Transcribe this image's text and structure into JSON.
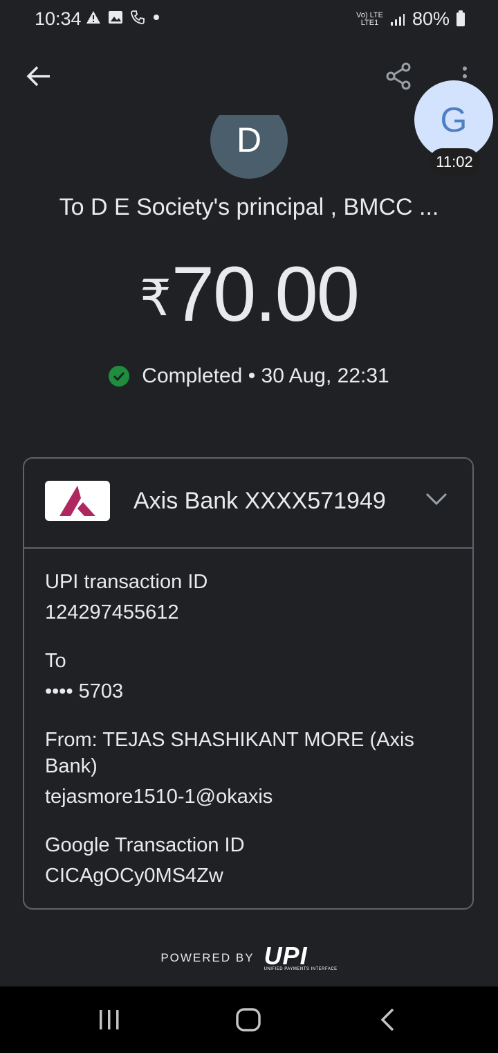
{
  "status_bar": {
    "time": "10:34",
    "net_top": "Vo) LTE",
    "net_bottom": "LTE1",
    "battery": "80%"
  },
  "bubble": {
    "letter": "G",
    "time": "11:02"
  },
  "payee": {
    "avatar_letter": "D",
    "to_line": "To D E Society's principal , BMCC ..."
  },
  "amount": {
    "currency": "₹",
    "value": "70.00"
  },
  "status": {
    "text": "Completed • 30 Aug, 22:31",
    "color": "#1e8e3e"
  },
  "account": {
    "bank_name": "Axis Bank XXXX571949",
    "brand_color": "#ae275f"
  },
  "details": {
    "upi_label": "UPI transaction ID",
    "upi_value": "124297455612",
    "to_label": "To",
    "to_value": "•••• 5703",
    "from_label_line1": "From: TEJAS SHASHIKANT MORE (Axis",
    "from_label_line2": "Bank)",
    "from_value": "tejasmore1510-1@okaxis",
    "google_label": "Google Transaction ID",
    "google_value": "CICAgOCy0MS4Zw"
  },
  "footer": {
    "powered_by": "POWERED BY",
    "upi_logo": "UPI",
    "upi_sub": "UNIFIED PAYMENTS INTERFACE"
  },
  "icons": {
    "back": "arrow-left-icon",
    "share": "share-icon",
    "more": "more-vert-icon",
    "check": "check-circle-icon",
    "chevron": "chevron-down-icon"
  }
}
